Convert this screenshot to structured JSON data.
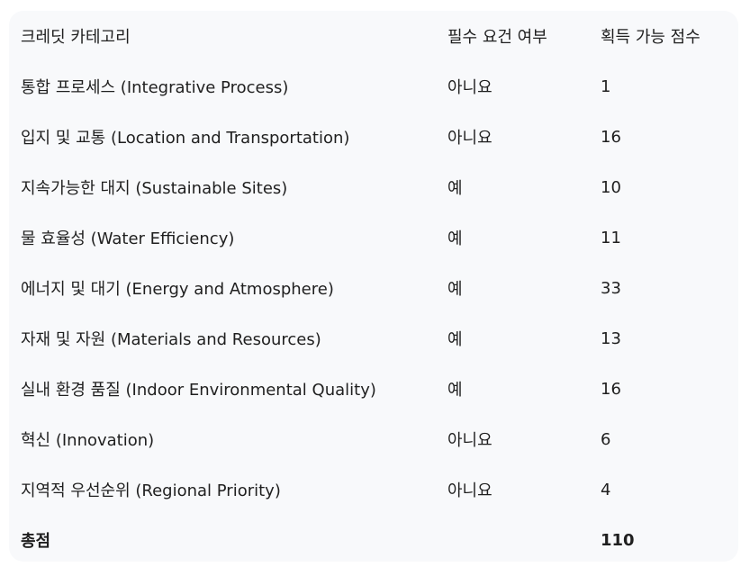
{
  "table": {
    "headers": [
      "크레딧 카테고리",
      "필수 요건 여부",
      "획득 가능 점수"
    ],
    "rows": [
      [
        "통합 프로세스 (Integrative Process)",
        "아니요",
        "1"
      ],
      [
        "입지 및 교통 (Location and Transportation)",
        "아니요",
        "16"
      ],
      [
        "지속가능한 대지 (Sustainable Sites)",
        "예",
        "10"
      ],
      [
        "물 효율성 (Water Efficiency)",
        "예",
        "11"
      ],
      [
        "에너지 및 대기 (Energy and Atmosphere)",
        "예",
        "33"
      ],
      [
        "자재 및 자원 (Materials and Resources)",
        "예",
        "13"
      ],
      [
        "실내 환경 품질 (Indoor Environmental Quality)",
        "예",
        "16"
      ],
      [
        "혁신 (Innovation)",
        "아니요",
        "6"
      ],
      [
        "지역적 우선순위 (Regional Priority)",
        "아니요",
        "4"
      ]
    ],
    "total": {
      "label": "총점",
      "required": "",
      "points": "110"
    }
  }
}
